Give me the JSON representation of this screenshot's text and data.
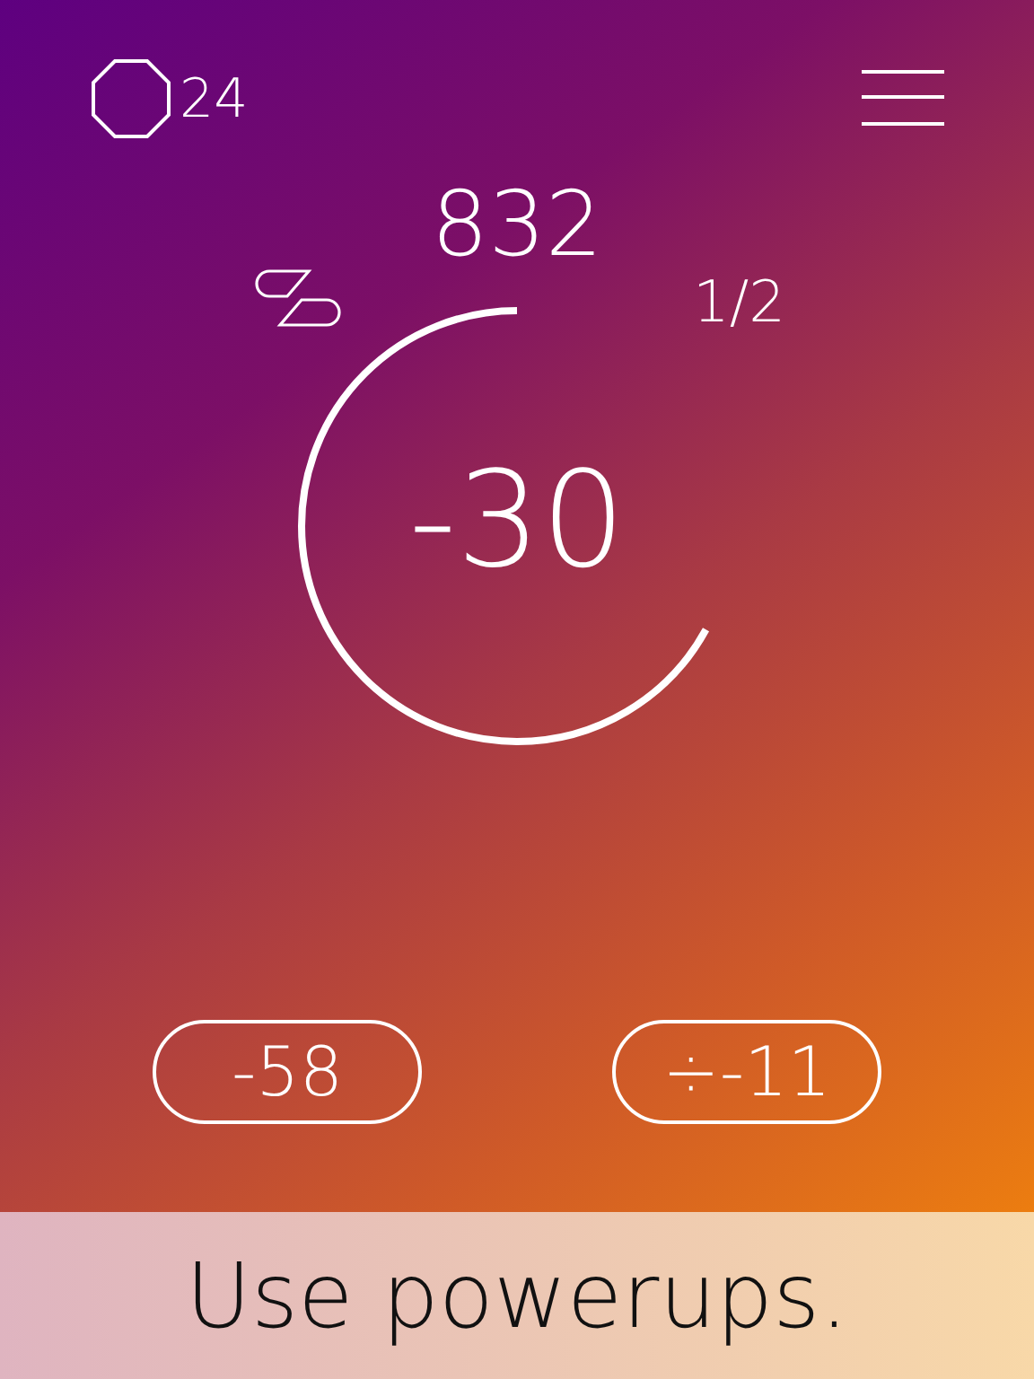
{
  "header": {
    "moves": "24"
  },
  "score": "832",
  "round": "1/2",
  "timer": {
    "value": "-30"
  },
  "powerups": [
    {
      "label": "-58"
    },
    {
      "label": "÷-11"
    }
  ],
  "banner": "Use powerups."
}
